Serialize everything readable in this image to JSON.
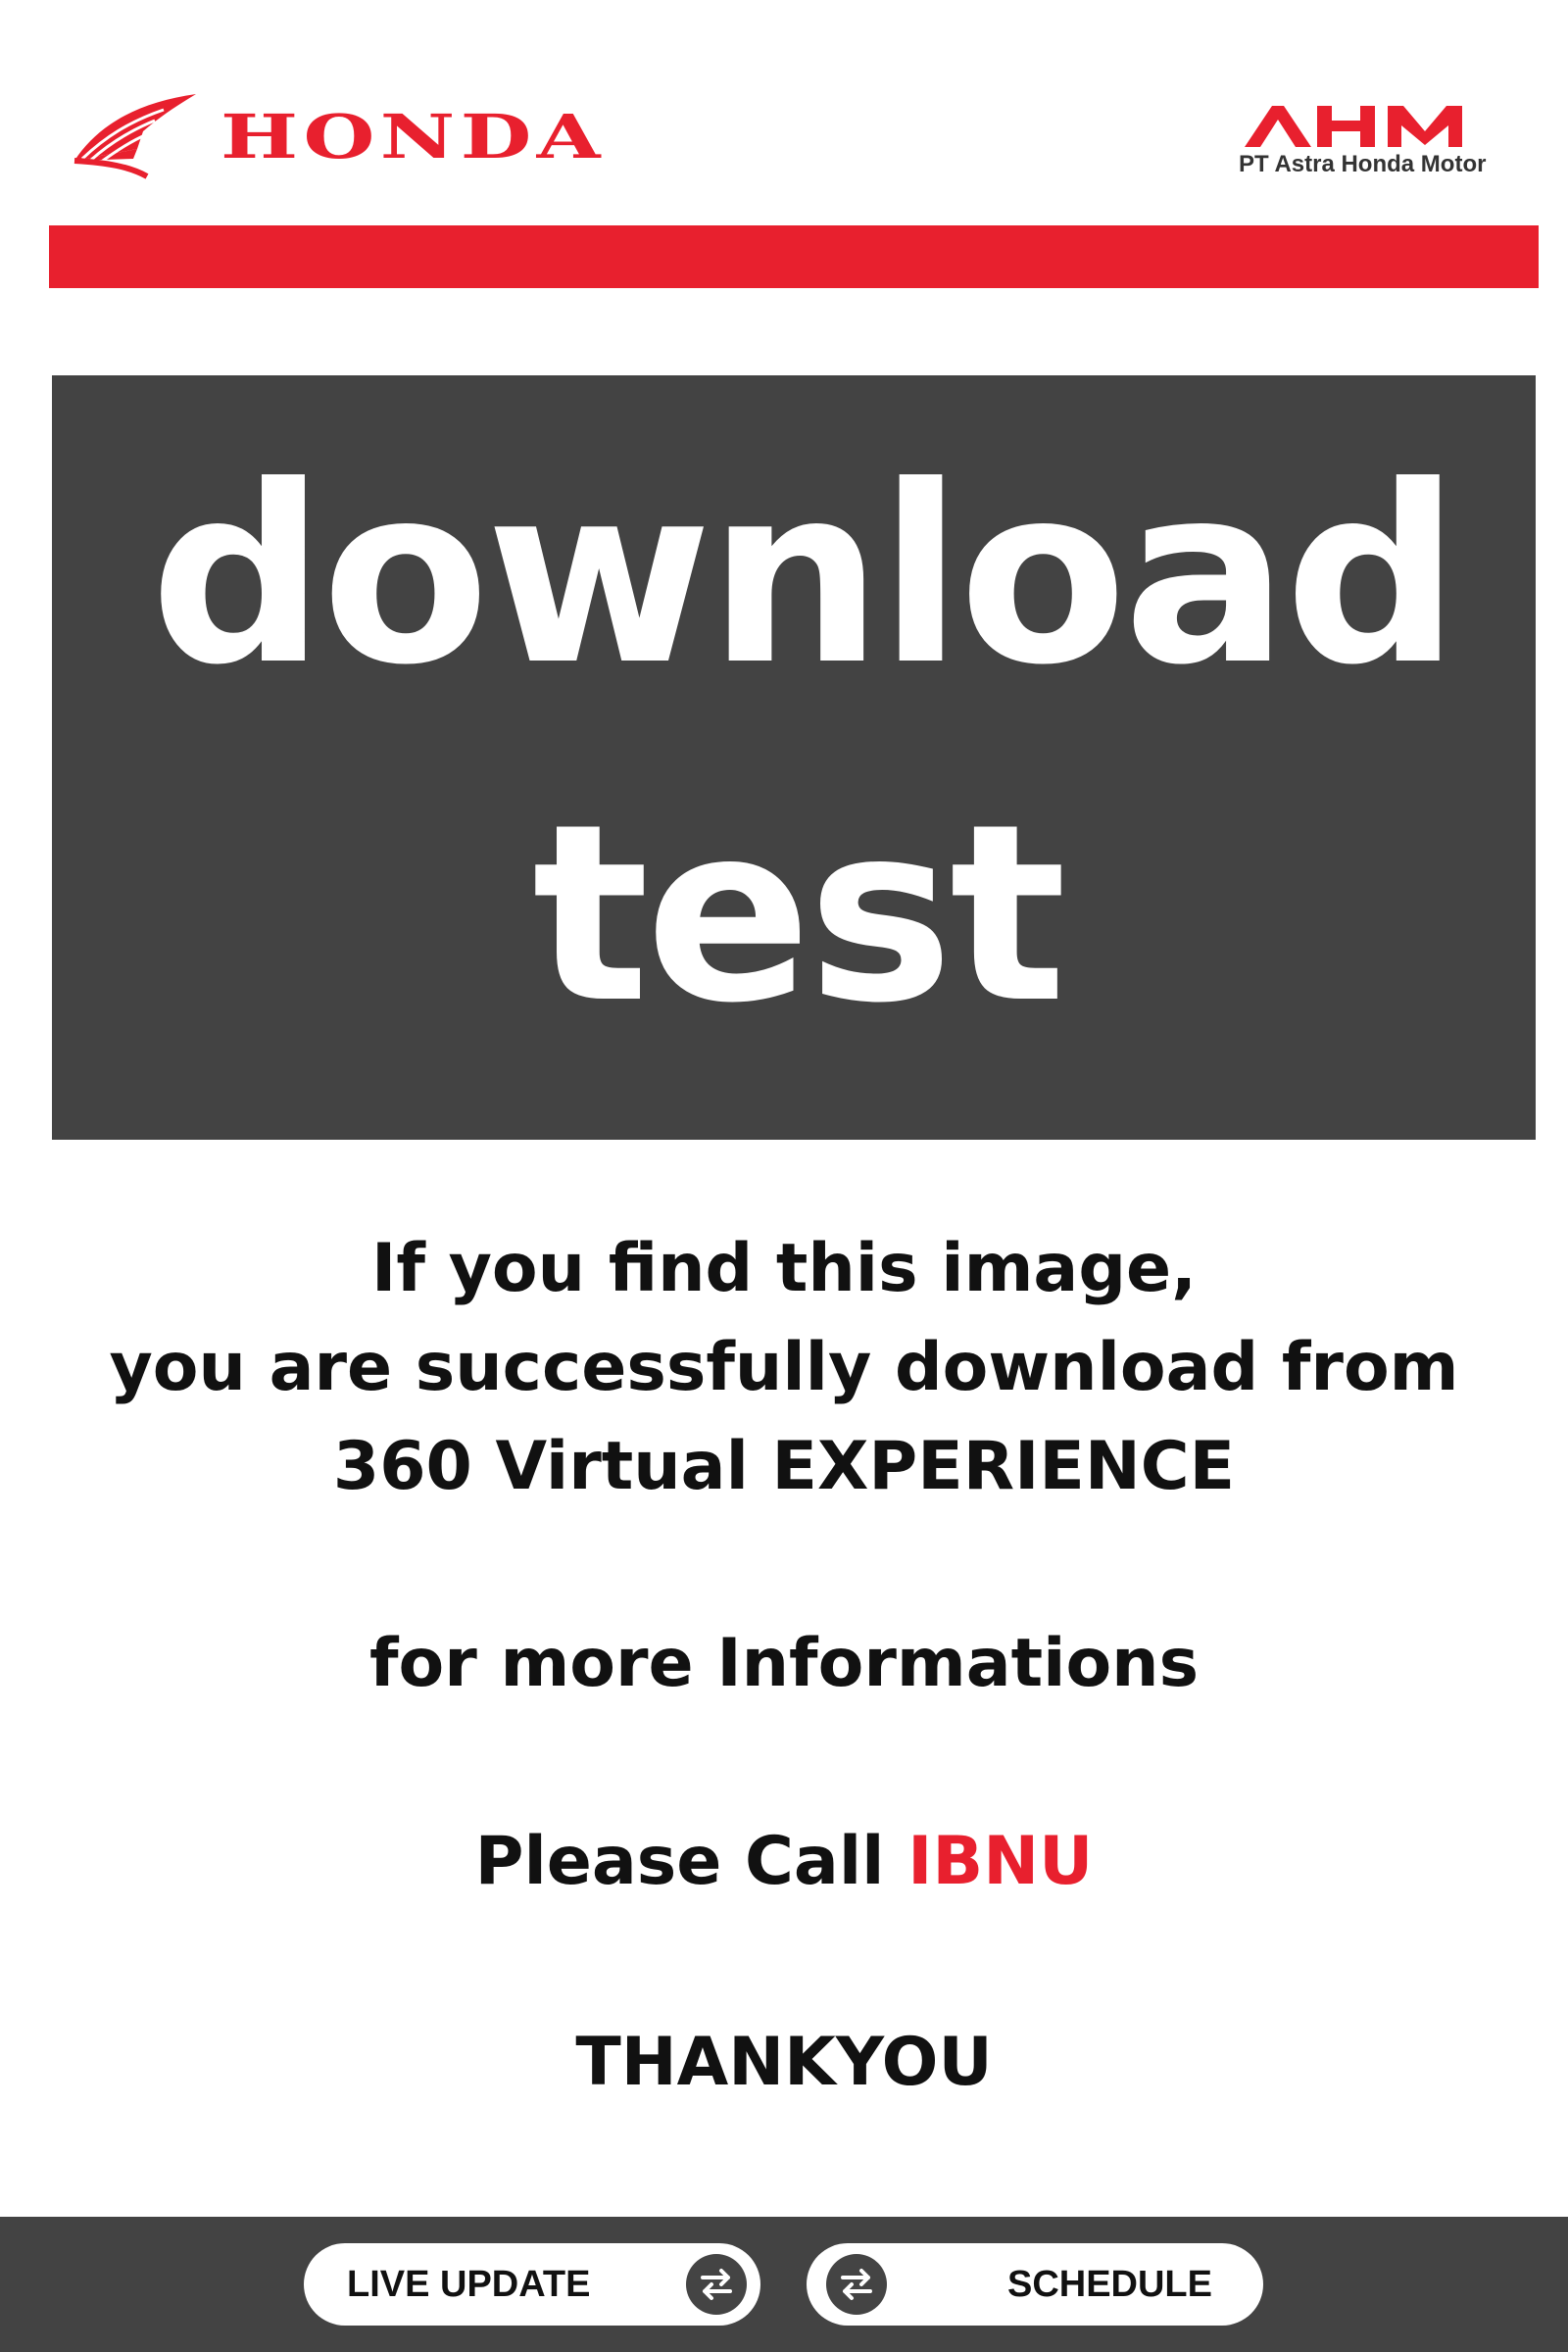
{
  "brand": {
    "honda": "HONDA",
    "ahm": "AHM",
    "ahm_subtitle": "PT Astra Honda Motor",
    "accent_color": "#E8202E",
    "dark_color": "#434343"
  },
  "hero": {
    "line1": "download",
    "line2": "test"
  },
  "message": {
    "line1": "If you find this image,",
    "line2": "you are successfully download from",
    "line3": "360 Virtual EXPERIENCE",
    "line4": "for more Informations",
    "line5_prefix": "Please Call ",
    "line5_name": "IBNU",
    "line6": "THANKYOU"
  },
  "bottom_nav": {
    "live_update": "LIVE UPDATE",
    "schedule": "SCHEDULE",
    "icon": "swap-arrows-icon"
  }
}
